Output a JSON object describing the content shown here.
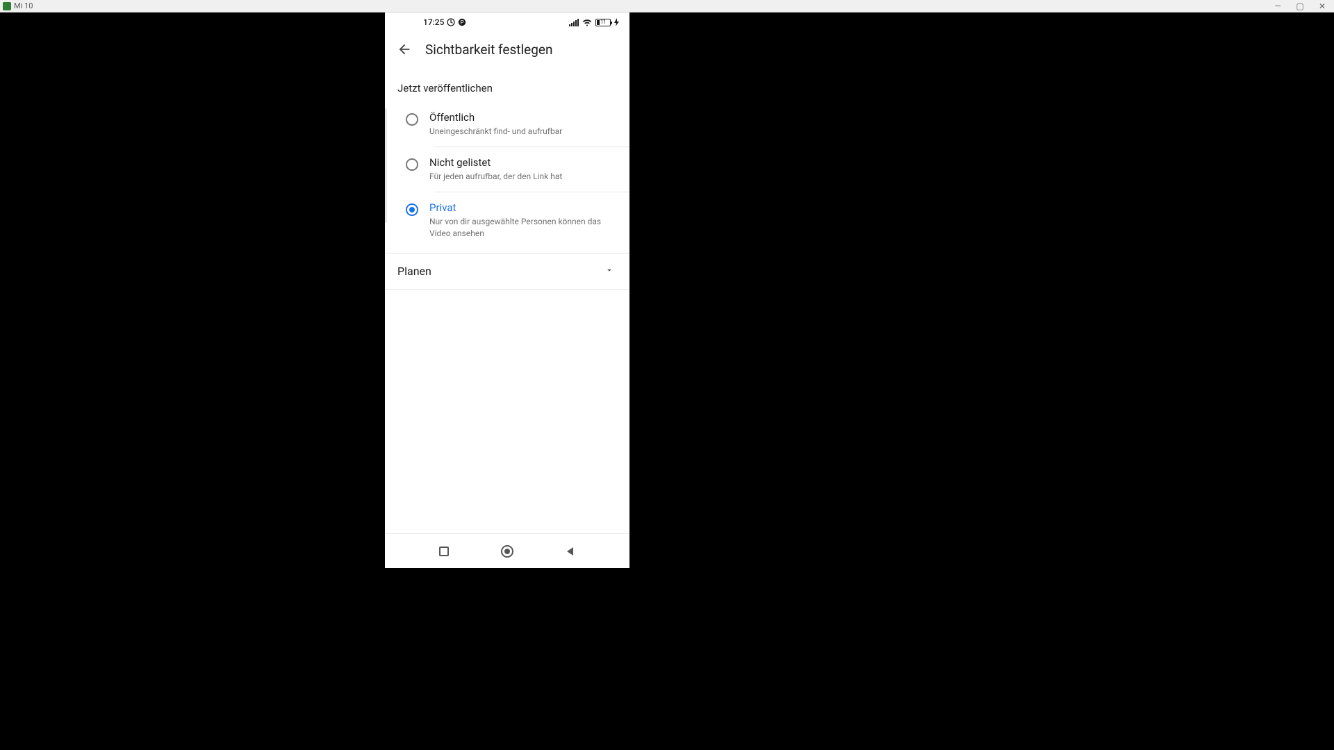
{
  "host_window": {
    "title": "Mi 10"
  },
  "status_bar": {
    "time": "17:25"
  },
  "app_bar": {
    "title": "Sichtbarkeit festlegen"
  },
  "section_publish_now": {
    "label": "Jetzt veröffentlichen"
  },
  "options": [
    {
      "title": "Öffentlich",
      "subtitle": "Uneingeschränkt find- und aufrufbar",
      "selected": false
    },
    {
      "title": "Nicht gelistet",
      "subtitle": "Für jeden aufrufbar, der den Link hat",
      "selected": false
    },
    {
      "title": "Privat",
      "subtitle": "Nur von dir ausgewählte Personen können das Video ansehen",
      "selected": true
    }
  ],
  "schedule_row": {
    "label": "Planen"
  },
  "colors": {
    "accent": "#1a73e8"
  }
}
